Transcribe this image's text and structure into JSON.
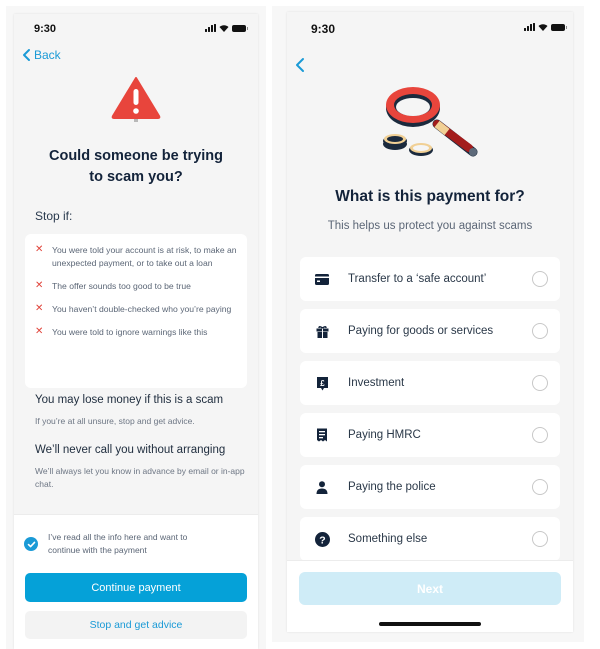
{
  "colors": {
    "accent": "#05a1d8",
    "link": "#1a9ad6",
    "warning_red": "#e0433a",
    "title_navy": "#13233a",
    "disabled_button": "#cfecf7"
  },
  "screen1": {
    "status_bar": {
      "time": "9:30",
      "icons": [
        "signal-icon",
        "wifi-icon",
        "battery-icon"
      ]
    },
    "back_label": "Back",
    "title_line1": "Could someone be trying",
    "title_line2": "to scam you?",
    "stop_if_label": "Stop if:",
    "stop_items": [
      {
        "icon": "cross-icon",
        "text": "You were told your account is at risk, to make an unexpected payment, or to take out a loan"
      },
      {
        "icon": "cross-icon",
        "text": "The offer sounds too good to be true"
      },
      {
        "icon": "cross-icon",
        "text": "You haven’t double-checked who you’re paying"
      },
      {
        "icon": "cross-icon",
        "text": "You were told to ignore warnings like this"
      }
    ],
    "lose_money_heading": "You may lose money if this is a scam",
    "lose_money_text": "If you’re at all unsure, stop and get advice.",
    "never_call_heading": "We’ll never call you without arranging",
    "never_call_text": "We’ll always let you know in advance by email or in-app chat.",
    "confirm_checkbox": {
      "checked": true,
      "label": "I’ve read all the info here and want to continue with the payment"
    },
    "continue_button": "Continue payment",
    "advice_button": "Stop and get advice"
  },
  "screen2": {
    "status_bar": {
      "time": "9:30",
      "icons": [
        "signal-icon",
        "wifi-icon",
        "battery-icon"
      ]
    },
    "title": "What is this payment for?",
    "subtitle": "This helps us protect you against scams",
    "options": [
      {
        "icon": "card-icon",
        "label": "Transfer to a ‘safe account’",
        "selected": false
      },
      {
        "icon": "gift-icon",
        "label": "Paying for goods or services",
        "selected": false
      },
      {
        "icon": "pound-icon",
        "label": "Investment",
        "selected": false
      },
      {
        "icon": "receipt-icon",
        "label": "Paying HMRC",
        "selected": false
      },
      {
        "icon": "person-icon",
        "label": "Paying the police",
        "selected": false
      },
      {
        "icon": "question-icon",
        "label": "Something else",
        "selected": false
      }
    ],
    "next_button": "Next",
    "next_enabled": false
  }
}
